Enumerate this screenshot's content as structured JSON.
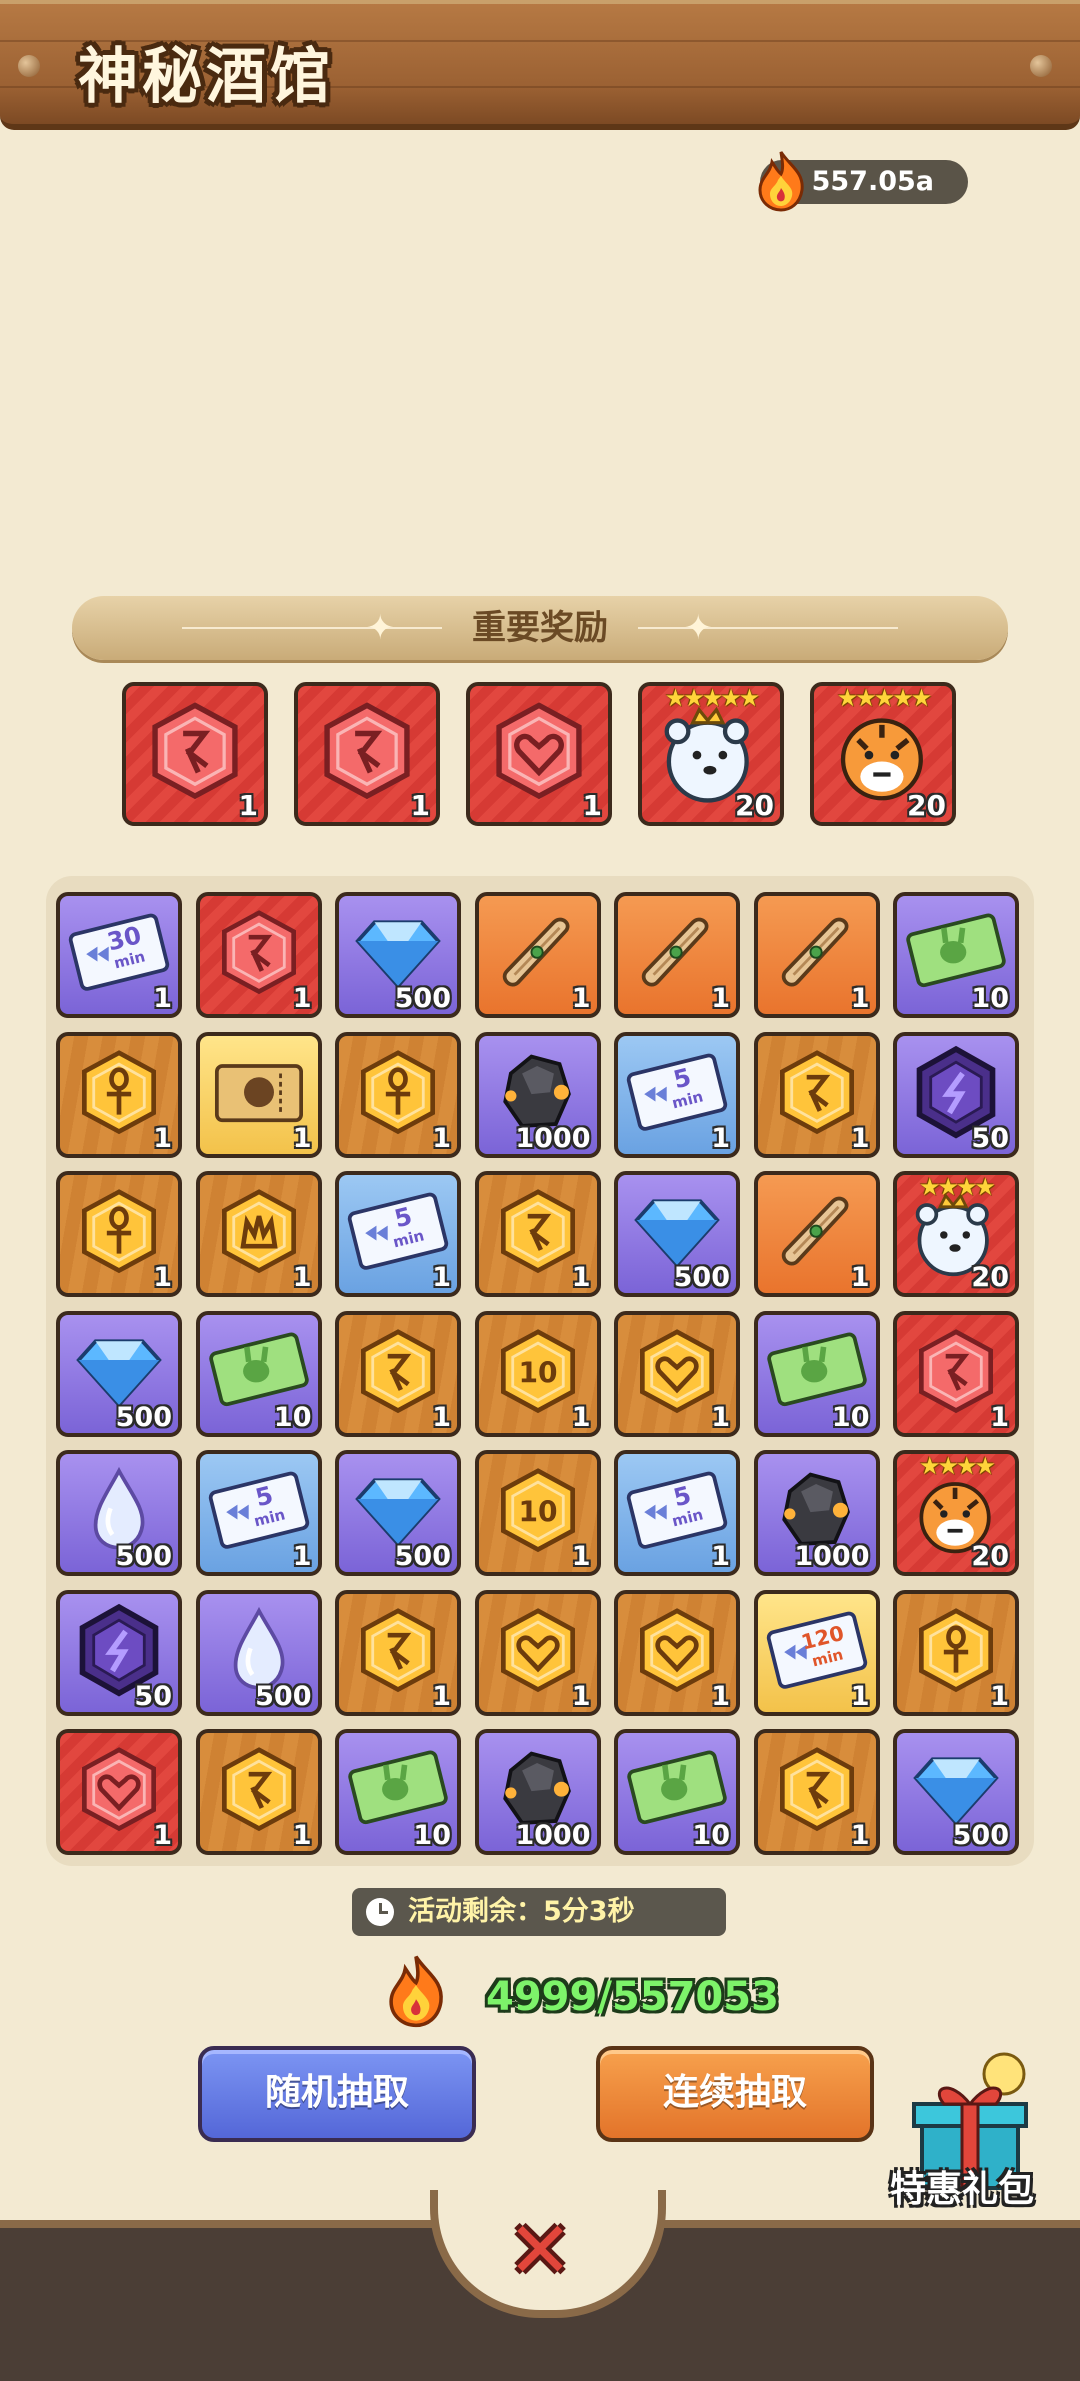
{
  "header": {
    "title": "神秘酒馆"
  },
  "currency": {
    "amount": "557.05a",
    "icon": "flame-icon"
  },
  "important_rewards": {
    "title": "重要奖励",
    "items": [
      {
        "icon": "red-rune-hex-icon",
        "style": "red",
        "count": "1"
      },
      {
        "icon": "red-rune-hex-icon",
        "style": "red",
        "count": "1"
      },
      {
        "icon": "red-heart-hex-icon",
        "style": "red",
        "count": "1"
      },
      {
        "icon": "polar-bear-hero-icon",
        "style": "red",
        "stars": "★★★★★",
        "count": "20"
      },
      {
        "icon": "tiger-hero-icon",
        "style": "red",
        "stars": "★★★★★",
        "count": "20"
      }
    ]
  },
  "grid": [
    [
      {
        "icon": "speedup-ticket-30min-icon",
        "style": "purple",
        "label": "30",
        "count": "1"
      },
      {
        "icon": "red-rune-hex-icon",
        "style": "red",
        "count": "1"
      },
      {
        "icon": "diamond-icon",
        "style": "purple",
        "count": "500"
      },
      {
        "icon": "scroll-icon",
        "style": "orange",
        "count": "1"
      },
      {
        "icon": "scroll-icon",
        "style": "orange",
        "count": "1"
      },
      {
        "icon": "scroll-icon",
        "style": "orange",
        "count": "1"
      },
      {
        "icon": "rabbit-ticket-icon",
        "style": "purple",
        "count": "10"
      }
    ],
    [
      {
        "icon": "gold-ankh-hex-icon",
        "style": "wood",
        "count": "1"
      },
      {
        "icon": "gold-ticket-icon",
        "style": "yellow",
        "count": "1"
      },
      {
        "icon": "gold-ankh-hex-icon",
        "style": "wood",
        "count": "1"
      },
      {
        "icon": "ore-icon",
        "style": "purple",
        "count": "1000"
      },
      {
        "icon": "speedup-ticket-5min-icon",
        "style": "blue",
        "label": "5",
        "count": "1"
      },
      {
        "icon": "gold-rune-hex-icon",
        "style": "wood",
        "count": "1"
      },
      {
        "icon": "purple-lightning-hex-icon",
        "style": "purple",
        "count": "50"
      }
    ],
    [
      {
        "icon": "gold-ankh-hex-icon",
        "style": "wood",
        "count": "1"
      },
      {
        "icon": "gold-crown-hex-icon",
        "style": "wood",
        "count": "1"
      },
      {
        "icon": "speedup-ticket-5min-icon",
        "style": "blue",
        "label": "5",
        "count": "1"
      },
      {
        "icon": "gold-rune-hex-icon",
        "style": "wood",
        "count": "1"
      },
      {
        "icon": "diamond-icon",
        "style": "purple",
        "count": "500"
      },
      {
        "icon": "scroll-icon",
        "style": "orange",
        "count": "1"
      },
      {
        "icon": "polar-bear-hero-icon",
        "style": "red",
        "stars": "★★★★",
        "count": "20"
      }
    ],
    [
      {
        "icon": "diamond-icon",
        "style": "purple",
        "count": "500"
      },
      {
        "icon": "rabbit-ticket-icon",
        "style": "purple",
        "count": "10"
      },
      {
        "icon": "gold-rune-hex-icon",
        "style": "wood",
        "count": "1"
      },
      {
        "icon": "gold-ten-hex-icon",
        "style": "wood",
        "count": "1"
      },
      {
        "icon": "gold-heart-hex-icon",
        "style": "wood",
        "count": "1"
      },
      {
        "icon": "rabbit-ticket-icon",
        "style": "purple",
        "count": "10"
      },
      {
        "icon": "red-rune-hex-icon",
        "style": "red",
        "count": "1"
      }
    ],
    [
      {
        "icon": "water-drop-icon",
        "style": "purple",
        "count": "500"
      },
      {
        "icon": "speedup-ticket-5min-icon",
        "style": "blue",
        "label": "5",
        "count": "1"
      },
      {
        "icon": "diamond-icon",
        "style": "purple",
        "count": "500"
      },
      {
        "icon": "gold-ten-hex-icon",
        "style": "wood",
        "count": "1"
      },
      {
        "icon": "speedup-ticket-5min-icon",
        "style": "blue",
        "label": "5",
        "count": "1"
      },
      {
        "icon": "ore-icon",
        "style": "purple",
        "count": "1000"
      },
      {
        "icon": "tiger-hero-icon",
        "style": "red",
        "stars": "★★★★",
        "count": "20"
      }
    ],
    [
      {
        "icon": "purple-lightning-hex-icon",
        "style": "purple",
        "count": "50"
      },
      {
        "icon": "water-drop-icon",
        "style": "purple",
        "count": "500"
      },
      {
        "icon": "gold-rune-hex-icon",
        "style": "wood",
        "count": "1"
      },
      {
        "icon": "gold-heart-hex-icon",
        "style": "wood",
        "count": "1"
      },
      {
        "icon": "gold-heart-hex-icon",
        "style": "wood",
        "count": "1"
      },
      {
        "icon": "speedup-ticket-120min-icon",
        "style": "yellow",
        "label": "120",
        "count": "1"
      },
      {
        "icon": "gold-ankh-hex-icon",
        "style": "wood",
        "count": "1"
      }
    ],
    [
      {
        "icon": "red-heart-hex-icon",
        "style": "red",
        "count": "1"
      },
      {
        "icon": "gold-rune-hex-icon",
        "style": "wood",
        "count": "1"
      },
      {
        "icon": "rabbit-ticket-icon",
        "style": "purple",
        "count": "10"
      },
      {
        "icon": "ore-icon",
        "style": "purple",
        "count": "1000"
      },
      {
        "icon": "rabbit-ticket-icon",
        "style": "purple",
        "count": "10"
      },
      {
        "icon": "gold-rune-hex-icon",
        "style": "wood",
        "count": "1"
      },
      {
        "icon": "diamond-icon",
        "style": "purple",
        "count": "500"
      }
    ]
  ],
  "timer": {
    "text": "活动剩余：5分3秒",
    "icon": "clock-icon"
  },
  "draw_progress": {
    "text": "4999/557053",
    "icon": "flame-icon"
  },
  "buttons": {
    "random_draw": "随机抽取",
    "continuous_draw": "连续抽取"
  },
  "gift": {
    "label": "特惠礼包",
    "icon": "gift-box-icon"
  },
  "close_icon": "close-icon",
  "colors": {
    "background": "#f3ead2",
    "header": "#9b6133",
    "progress_text": "#7df36a"
  }
}
